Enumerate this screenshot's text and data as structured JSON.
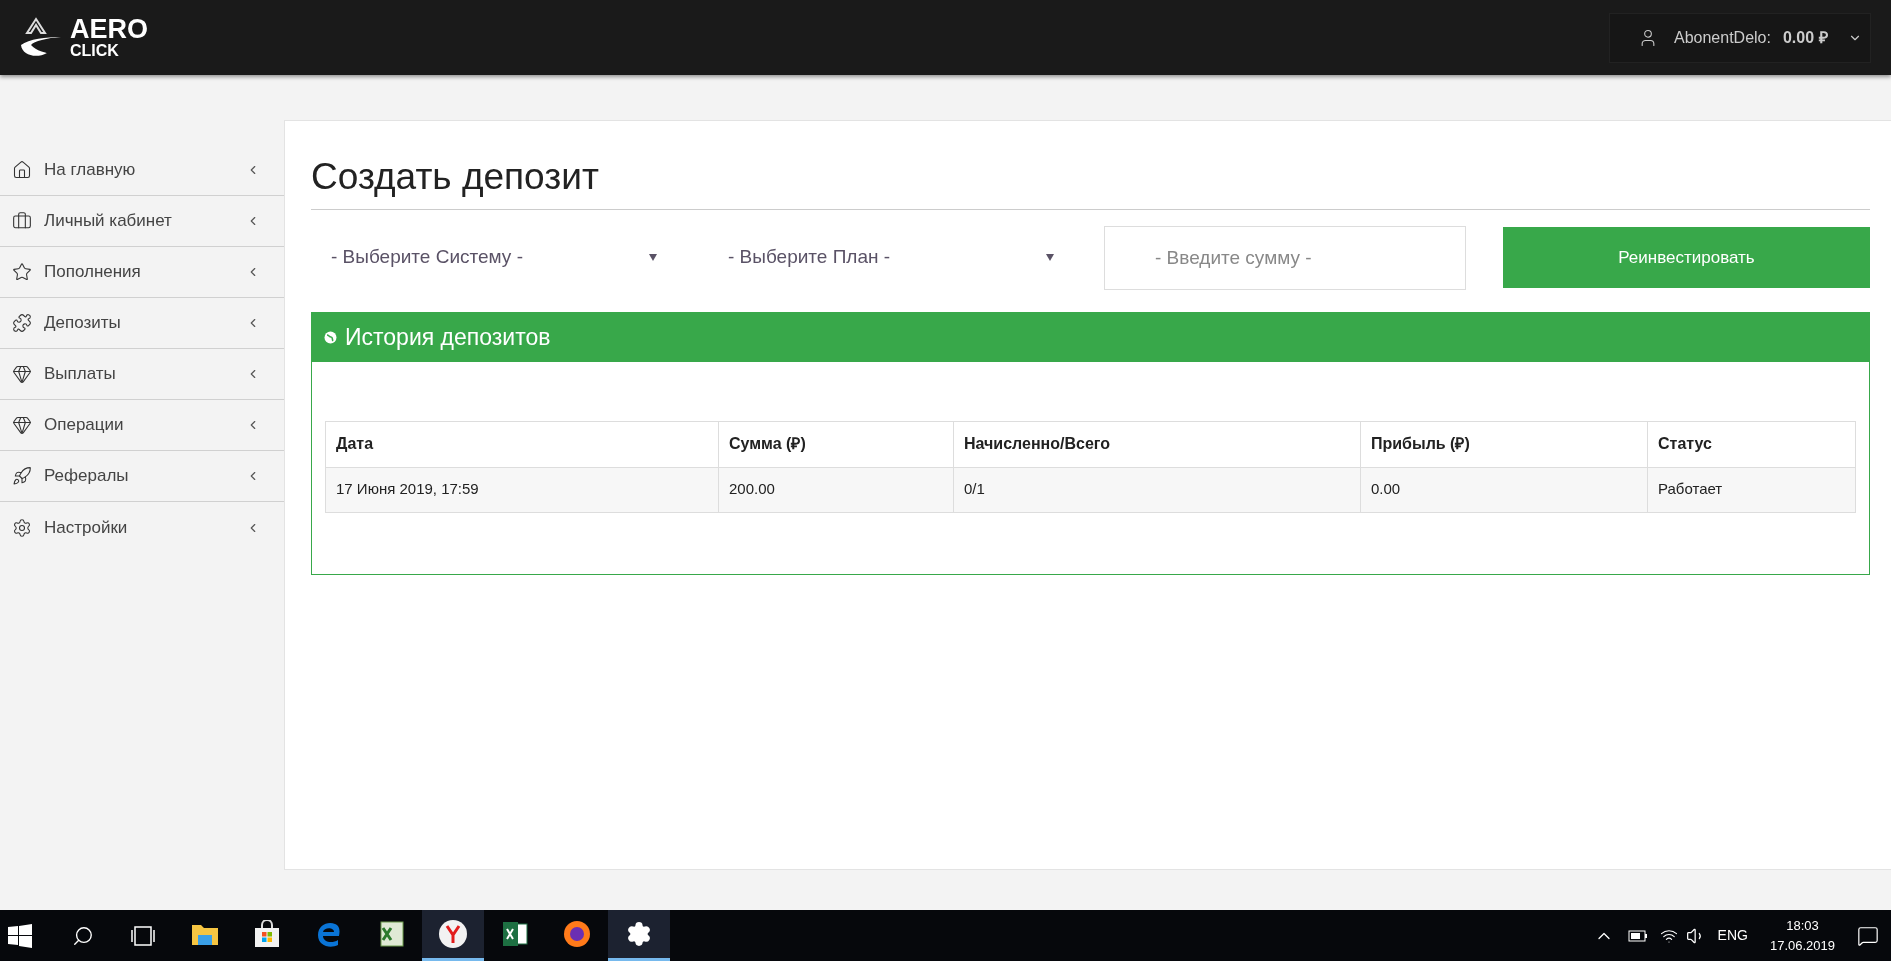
{
  "header": {
    "logo": {
      "line1": "AERO",
      "line2": "CLICK"
    },
    "user": {
      "name": "AbonentDelo:",
      "balance": "0.00",
      "currency": "₽"
    }
  },
  "sidebar": {
    "items": [
      {
        "label": "На главную"
      },
      {
        "label": "Личный кабинет"
      },
      {
        "label": "Пополнения"
      },
      {
        "label": "Депозиты"
      },
      {
        "label": "Выплаты"
      },
      {
        "label": "Операции"
      },
      {
        "label": "Рефералы"
      },
      {
        "label": "Настройки"
      }
    ]
  },
  "page": {
    "title": "Создать депозит",
    "system_select": {
      "value": "- Выберите Систему -"
    },
    "plan_select": {
      "value": "- Выберите План -"
    },
    "amount_field": {
      "placeholder": "- Введите сумму -"
    },
    "submit_button": "Реинвестировать"
  },
  "history": {
    "title": "История депозитов",
    "table": {
      "columns": [
        "Дата",
        "Сумма (₽)",
        "Начисленно/Всего",
        "Прибыль (₽)",
        "Статус"
      ],
      "rows": [
        [
          "17 Июня 2019, 17:59",
          "200.00",
          "0/1",
          "0.00",
          "Работает"
        ]
      ]
    }
  },
  "taskbar": {
    "apps": [
      {
        "running": false
      },
      {
        "running": false
      },
      {
        "running": false
      },
      {
        "running": false
      },
      {
        "running": true
      },
      {
        "running": false
      },
      {
        "running": false
      },
      {
        "running": true
      }
    ],
    "language": "ENG",
    "time": "18:03",
    "date": "17.06.2019"
  }
}
